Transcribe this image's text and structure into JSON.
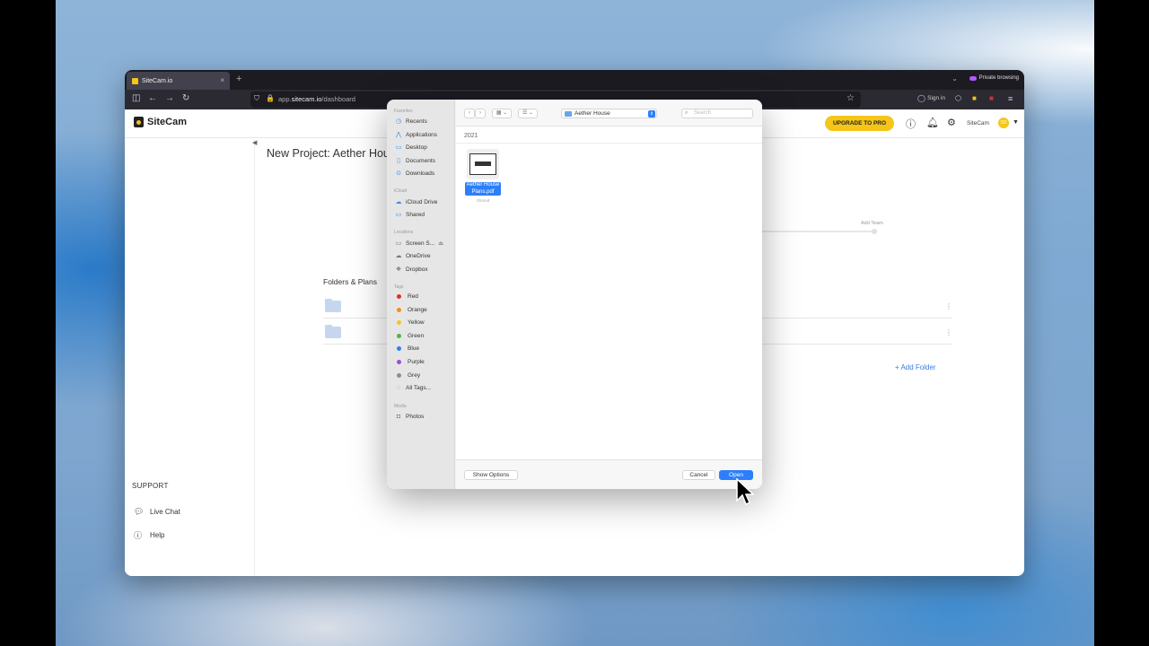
{
  "browser": {
    "tab_title": "SiteCam.io",
    "tab_close": "×",
    "new_tab": "+",
    "private_label": "Private browsing",
    "url_prefix": "app.",
    "url_domain": "sitecam.io",
    "url_path": "/dashboard",
    "signin_label": "Sign in"
  },
  "app": {
    "logo_text": "SiteCam",
    "upgrade_label": "UPGRADE TO PRO",
    "user_name": "SiteCam",
    "avatar_initials": "SD",
    "page_title": "New Project: Aether Hou",
    "add_team_label": "Add Team",
    "folders_title": "Folders & Plans",
    "add_folder_label": "Add Folder",
    "support": {
      "title": "SUPPORT",
      "items": [
        {
          "label": "Live Chat",
          "icon": "chat-icon"
        },
        {
          "label": "Help",
          "icon": "help-circle-icon"
        }
      ]
    }
  },
  "dialog": {
    "sections": {
      "favorites": "Favorites",
      "icloud": "iCloud",
      "locations": "Locations",
      "tags": "Tags",
      "media": "Media"
    },
    "favorites": [
      "Recents",
      "Applications",
      "Desktop",
      "Documents",
      "Downloads"
    ],
    "icloud": [
      "iCloud Drive",
      "Shared"
    ],
    "locations": [
      "Screen S...",
      "OneDrive",
      "Dropbox"
    ],
    "tags": [
      {
        "label": "Red",
        "color": "#e0312b"
      },
      {
        "label": "Orange",
        "color": "#f2911c"
      },
      {
        "label": "Yellow",
        "color": "#f3c624"
      },
      {
        "label": "Green",
        "color": "#4cb748"
      },
      {
        "label": "Blue",
        "color": "#2f7ff0"
      },
      {
        "label": "Purple",
        "color": "#a04bd5"
      },
      {
        "label": "Grey",
        "color": "#8e8e8e"
      }
    ],
    "all_tags": "All Tags...",
    "media": [
      "Photos"
    ],
    "location_select": "Aether House",
    "search_placeholder": "Search",
    "group_header": "2021",
    "file": {
      "name_line1": "Aether House",
      "name_line2": "Plans.pdf",
      "sub": "Shared"
    },
    "show_options": "Show Options",
    "cancel": "Cancel",
    "open": "Open"
  },
  "colors": {
    "accent": "#f5c518",
    "dialog_blue": "#2d7ff9",
    "link_blue": "#3b7ddd"
  }
}
